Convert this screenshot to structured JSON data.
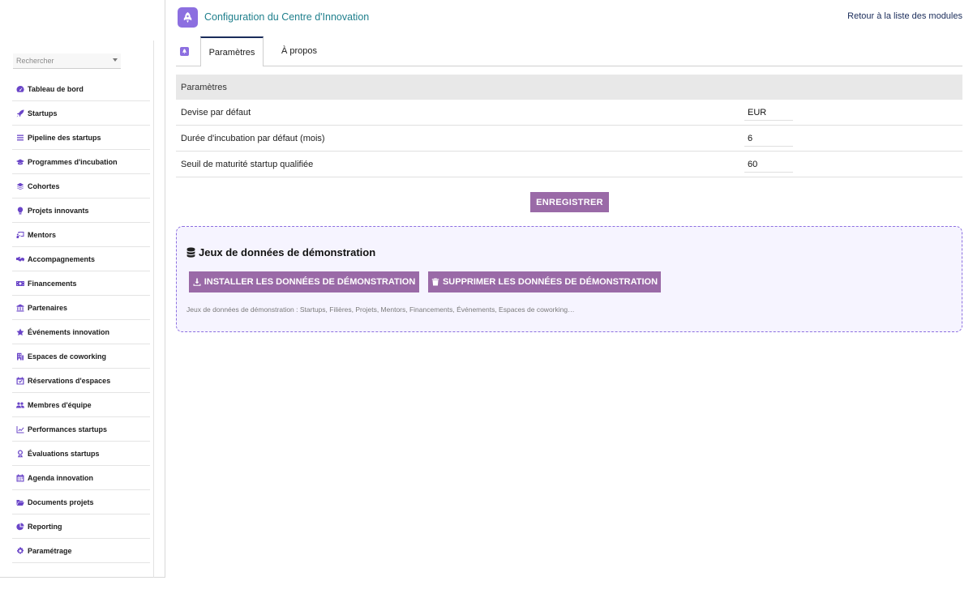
{
  "header": {
    "title": "Configuration du Centre d'Innovation",
    "back_link": "Retour à la liste des modules",
    "logo_icon": "rocket-icon",
    "accent_color": "#8c6fe0"
  },
  "sidebar": {
    "search_placeholder": "Rechercher",
    "items": [
      {
        "label": "Tableau de bord",
        "icon": "dashboard-icon"
      },
      {
        "label": "Startups",
        "icon": "rocket-icon"
      },
      {
        "label": "Pipeline des startups",
        "icon": "list-icon"
      },
      {
        "label": "Programmes d'incubation",
        "icon": "graduation-cap-icon"
      },
      {
        "label": "Cohortes",
        "icon": "layers-icon"
      },
      {
        "label": "Projets innovants",
        "icon": "lightbulb-icon"
      },
      {
        "label": "Mentors",
        "icon": "chalkboard-teacher-icon"
      },
      {
        "label": "Accompagnements",
        "icon": "handshake-icon"
      },
      {
        "label": "Financements",
        "icon": "money-bill-icon"
      },
      {
        "label": "Partenaires",
        "icon": "landmark-icon"
      },
      {
        "label": "Événements innovation",
        "icon": "star-icon"
      },
      {
        "label": "Espaces de coworking",
        "icon": "building-icon"
      },
      {
        "label": "Réservations d'espaces",
        "icon": "calendar-check-icon"
      },
      {
        "label": "Membres d'équipe",
        "icon": "users-icon"
      },
      {
        "label": "Performances startups",
        "icon": "chart-line-icon"
      },
      {
        "label": "Évaluations startups",
        "icon": "award-icon"
      },
      {
        "label": "Agenda innovation",
        "icon": "calendar-icon"
      },
      {
        "label": "Documents projets",
        "icon": "folder-open-icon"
      },
      {
        "label": "Reporting",
        "icon": "pie-chart-icon"
      },
      {
        "label": "Paramétrage",
        "icon": "gear-icon"
      }
    ]
  },
  "tabs": [
    {
      "label": "Paramètres",
      "active": true
    },
    {
      "label": "À propos",
      "active": false
    }
  ],
  "params": {
    "section_title": "Paramètres",
    "rows": [
      {
        "label": "Devise par défaut",
        "value": "EUR"
      },
      {
        "label": "Durée d'incubation par défaut (mois)",
        "value": "6"
      },
      {
        "label": "Seuil de maturité startup qualifiée",
        "value": "60"
      }
    ],
    "save_label": "ENREGISTRER"
  },
  "demo": {
    "title": "Jeux de données de démonstration",
    "title_icon": "database-icon",
    "install_label": "INSTALLER LES DONNÉES DE DÉMONSTRATION",
    "install_icon": "download-icon",
    "remove_label": "SUPPRIMER LES DONNÉES DE DÉMONSTRATION",
    "remove_icon": "trash-icon",
    "note": "Jeux de données de démonstration : Startups, Filières, Projets, Mentors, Financements, Événements, Espaces de coworking…"
  }
}
